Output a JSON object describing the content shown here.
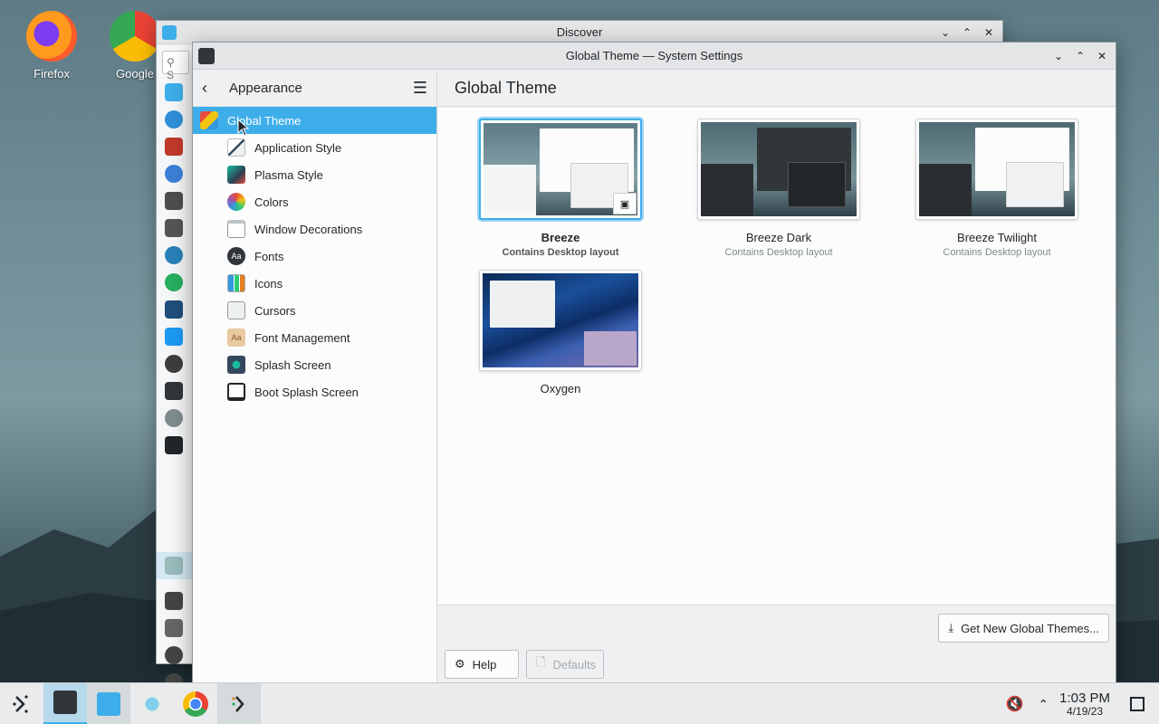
{
  "desktop": {
    "icons": [
      {
        "label": "Firefox"
      },
      {
        "label": "Google"
      }
    ]
  },
  "discover_window": {
    "title": "Discover",
    "search_placeholder": "S"
  },
  "settings_window": {
    "title": "Global Theme — System Settings",
    "sidebar": {
      "back_label": "Appearance",
      "items": [
        {
          "label": "Global Theme",
          "icon": "global-theme-icon",
          "selected": true
        },
        {
          "label": "Application Style",
          "icon": "application-style-icon"
        },
        {
          "label": "Plasma Style",
          "icon": "plasma-style-icon"
        },
        {
          "label": "Colors",
          "icon": "colors-icon"
        },
        {
          "label": "Window Decorations",
          "icon": "window-decorations-icon"
        },
        {
          "label": "Fonts",
          "icon": "fonts-icon"
        },
        {
          "label": "Icons",
          "icon": "icons-icon"
        },
        {
          "label": "Cursors",
          "icon": "cursors-icon"
        },
        {
          "label": "Font Management",
          "icon": "font-management-icon"
        },
        {
          "label": "Splash Screen",
          "icon": "splash-screen-icon"
        },
        {
          "label": "Boot Splash Screen",
          "icon": "boot-splash-screen-icon"
        }
      ]
    },
    "main": {
      "title": "Global Theme",
      "themes": [
        {
          "name": "Breeze",
          "subtitle": "Contains Desktop layout",
          "selected": true
        },
        {
          "name": "Breeze Dark",
          "subtitle": "Contains Desktop layout"
        },
        {
          "name": "Breeze Twilight",
          "subtitle": "Contains Desktop layout"
        },
        {
          "name": "Oxygen",
          "subtitle": ""
        }
      ],
      "get_new_label": "Get New Global Themes...",
      "help_label": "Help",
      "defaults_label": "Defaults"
    }
  },
  "taskbar": {
    "clock_time": "1:03 PM",
    "clock_date": "4/19/23"
  },
  "colors": {
    "accent": "#3daee9",
    "window_bg": "#eff0f1",
    "view_bg": "#fcfcfc"
  }
}
